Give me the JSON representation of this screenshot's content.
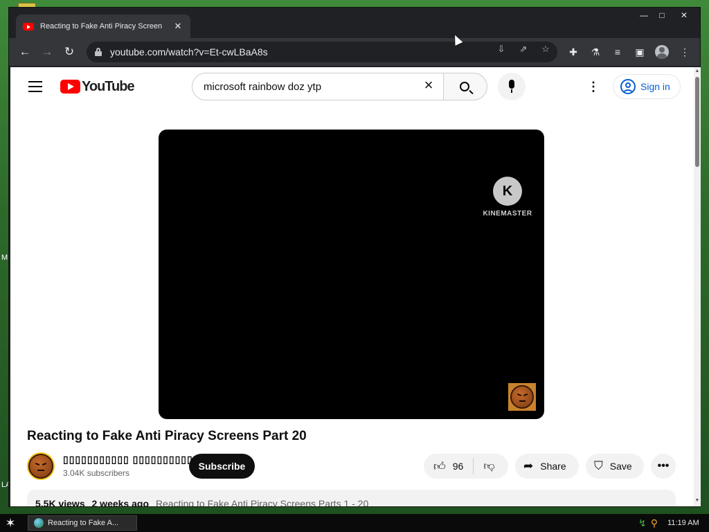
{
  "desktop": {
    "side_letters": [
      "M",
      "LA"
    ]
  },
  "browser": {
    "tab": {
      "title": "Reacting to Fake Anti Piracy Screen",
      "close": "✕"
    },
    "window_controls": {
      "minimize": "—",
      "maximize": "□",
      "close": "✕"
    },
    "toolbar": {
      "back": "←",
      "forward": "→",
      "reload": "↻",
      "url": "youtube.com/watch?v=Et-cwLBaA8s"
    },
    "toolbar_icons": [
      "install-icon",
      "share-icon",
      "star-icon",
      "extensions-icon",
      "labs-icon",
      "reading-list-icon",
      "side-panel-icon",
      "profile-icon",
      "kebab-menu-icon"
    ]
  },
  "youtube": {
    "logo_text": "YouTube",
    "search": {
      "query": "microsoft rainbow doz ytp"
    },
    "signin_label": "Sign in",
    "player": {
      "watermark": "KINEMASTER",
      "watermark_letter": "K"
    },
    "video": {
      "title": "Reacting to Fake Anti Piracy Screens Part 20",
      "channel_name": "▯▯▯▯▯▯▯▯▯▯▯ ▯▯▯▯▯▯▯▯▯▯▯",
      "subscribers": "3.04K subscribers",
      "subscribe_label": "Subscribe",
      "likes": "96",
      "share_label": "Share",
      "save_label": "Save",
      "more": "•••"
    },
    "description": {
      "views": "5.5K views",
      "age": "2 weeks ago",
      "tag": "Reacting to Fake Anti Piracy Screens Parts 1 - 20"
    }
  },
  "taskbar": {
    "task_label": "Reacting to Fake A...",
    "clock": "11:19 AM"
  },
  "colors": {
    "youtube_red": "#ff0000",
    "signin_blue": "#065fd4",
    "chrome_dark": "#202124"
  }
}
